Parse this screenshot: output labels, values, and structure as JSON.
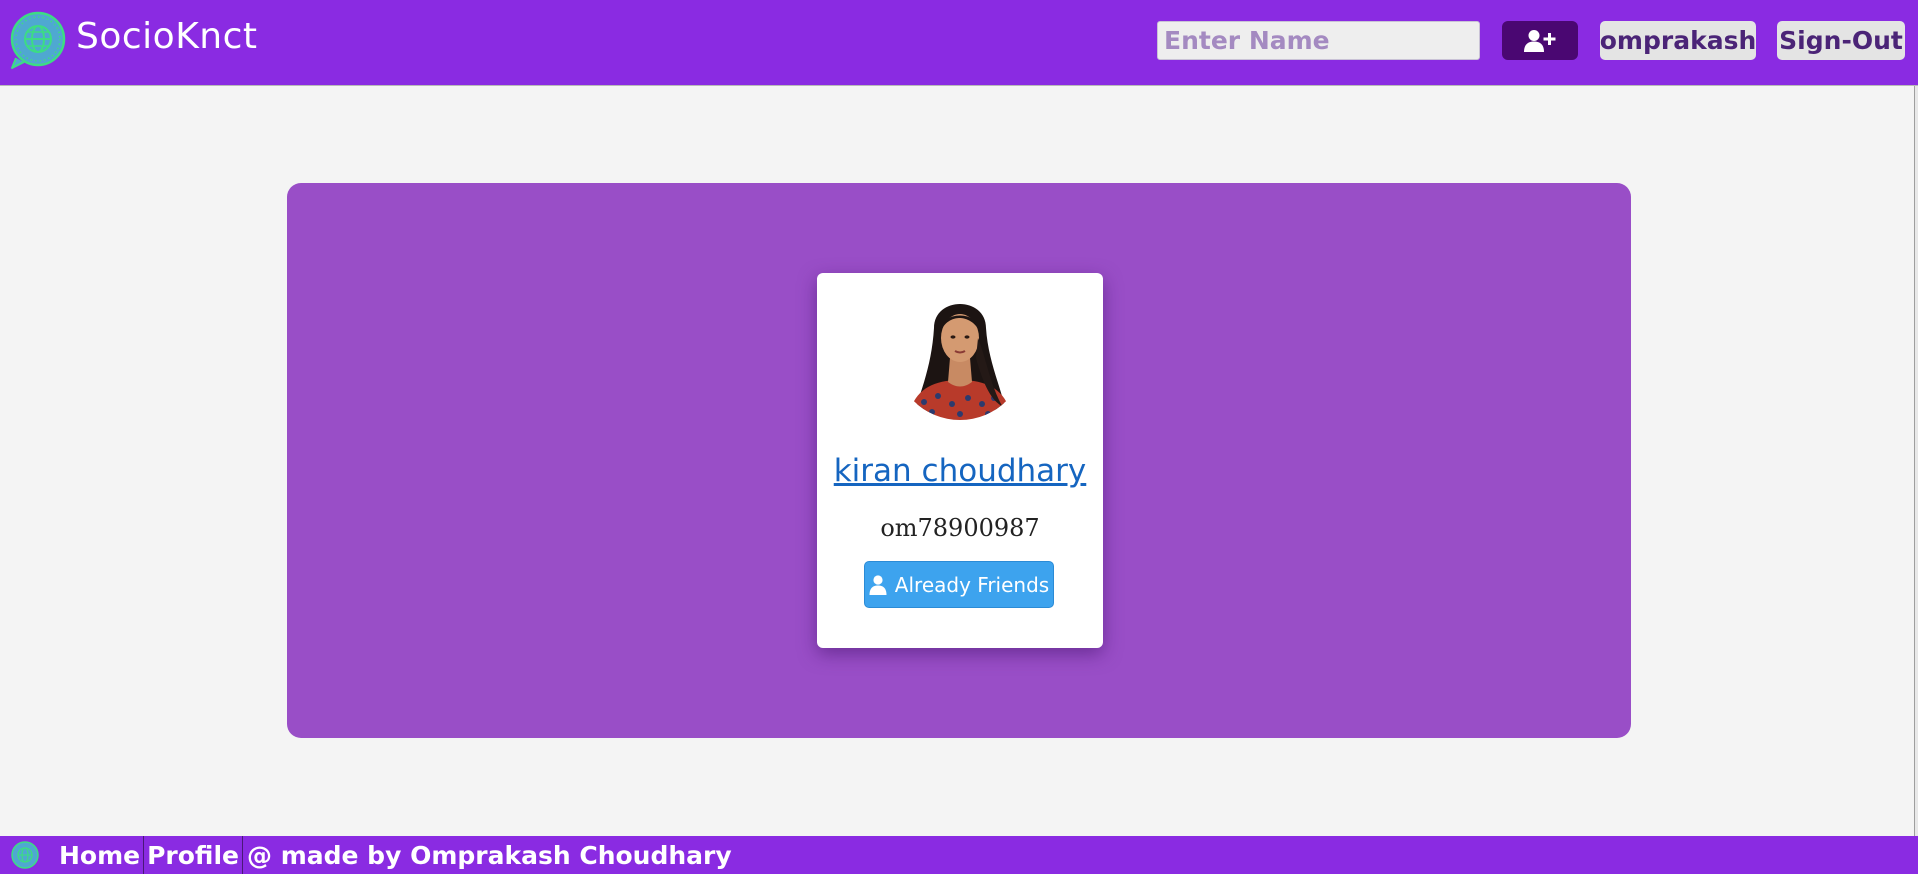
{
  "header": {
    "brand": "SocioKnct",
    "search_placeholder": "Enter Name",
    "search_value": "",
    "add_friend_icon": "user-plus-icon",
    "user_label": "omprakash",
    "signout_label": "Sign-Out"
  },
  "profile_card": {
    "name": "kiran choudhary",
    "username": "om78900987",
    "friend_button_label": "Already Friends",
    "friend_button_icon": "user-icon",
    "avatar": "avatar-photo"
  },
  "footer": {
    "links": [
      "Home",
      "Profile"
    ],
    "credit": "@ made by Omprakash Choudhary"
  },
  "colors": {
    "brand": "#8a2be2",
    "panel": "#994ec7",
    "add_friend_button": "#4a0772",
    "friend_button": "#3da3ee",
    "profile_link": "#1565c0",
    "logo_accent": "#3ddc84"
  }
}
